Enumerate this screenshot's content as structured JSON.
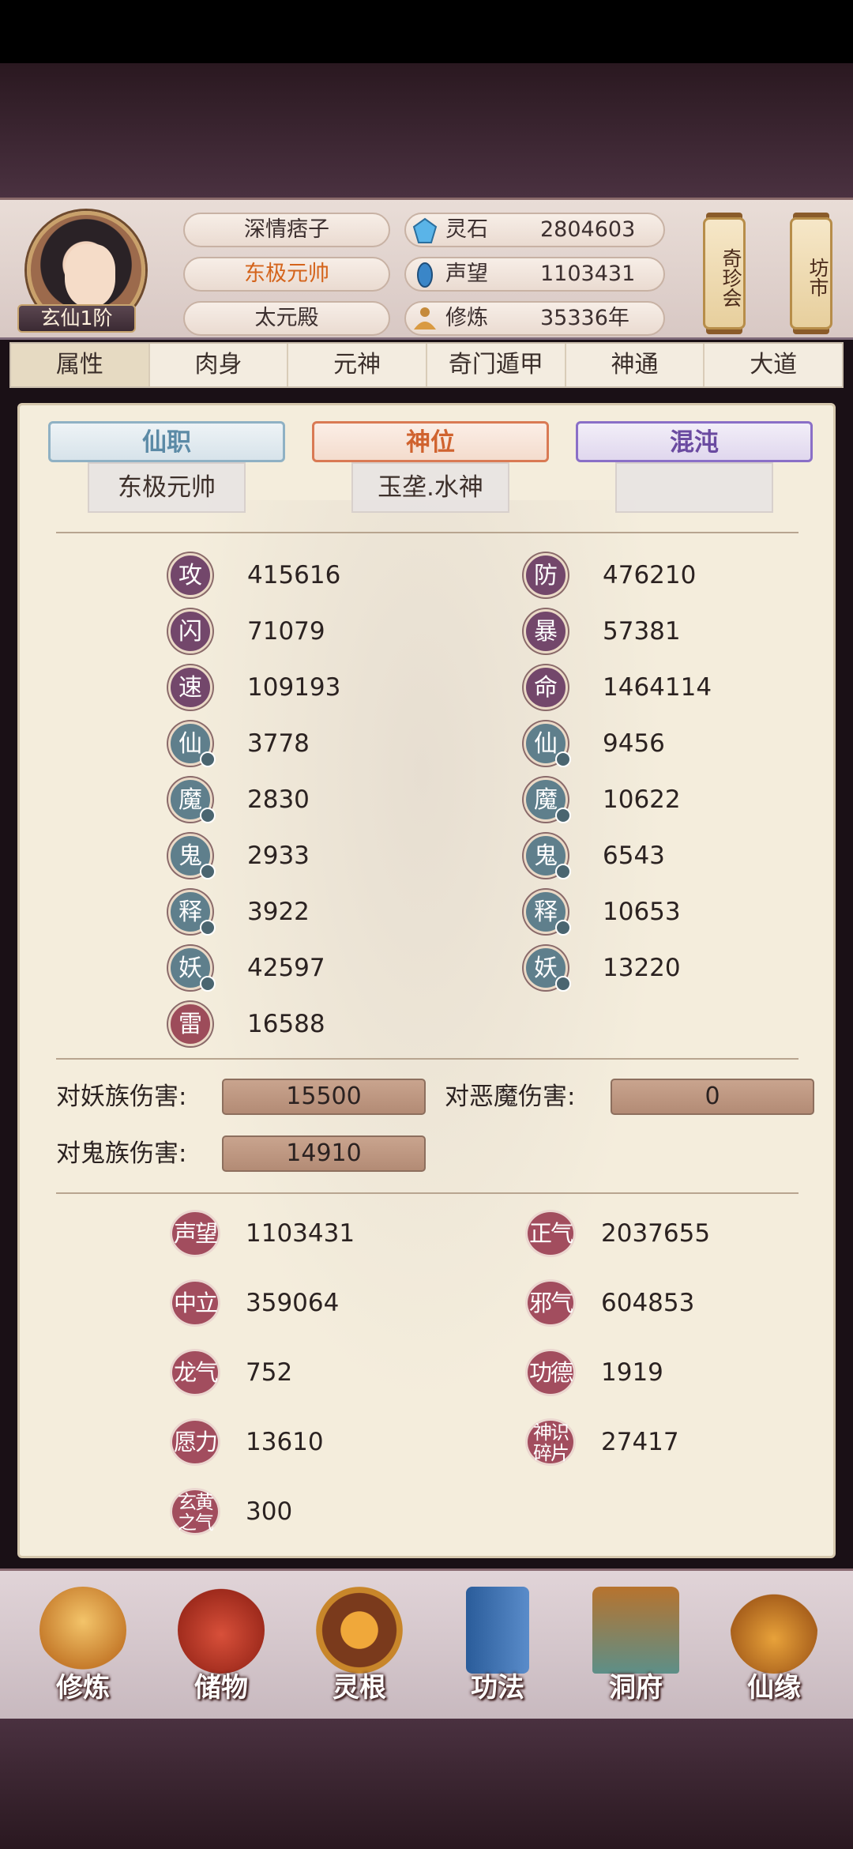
{
  "player": {
    "realm": "玄仙1阶",
    "name": "深情痞子",
    "title": "东极元帅",
    "palace": "太元殿"
  },
  "resources": [
    {
      "icon": "spirit-stone-icon",
      "label": "灵石",
      "value": "2804603"
    },
    {
      "icon": "prestige-icon",
      "label": "声望",
      "value": "1103431"
    },
    {
      "icon": "cultivation-icon",
      "label": "修炼",
      "value": "35336年"
    }
  ],
  "side_buttons": {
    "treasure_fair": "奇珍会",
    "market": "坊市"
  },
  "tabs": [
    "属性",
    "肉身",
    "元神",
    "奇门遁甲",
    "神通",
    "大道"
  ],
  "positions": {
    "immortal_post_title": "仙职",
    "immortal_post_value": "东极元帅",
    "divine_rank_title": "神位",
    "divine_rank_value": "玉垄.水神",
    "chaos_title": "混沌",
    "chaos_value": ""
  },
  "stats_left": [
    {
      "badge": "攻",
      "value": "415616",
      "color": "purple",
      "dot": false
    },
    {
      "badge": "闪",
      "value": "71079",
      "color": "purple",
      "dot": false
    },
    {
      "badge": "速",
      "value": "109193",
      "color": "purple",
      "dot": false
    },
    {
      "badge": "仙",
      "value": "3778",
      "color": "blue",
      "dot": true
    },
    {
      "badge": "魔",
      "value": "2830",
      "color": "blue",
      "dot": true
    },
    {
      "badge": "鬼",
      "value": "2933",
      "color": "blue",
      "dot": true
    },
    {
      "badge": "释",
      "value": "3922",
      "color": "blue",
      "dot": true
    },
    {
      "badge": "妖",
      "value": "42597",
      "color": "blue",
      "dot": true
    },
    {
      "badge": "雷",
      "value": "16588",
      "color": "red",
      "dot": false
    }
  ],
  "stats_right": [
    {
      "badge": "防",
      "value": "476210",
      "color": "purple",
      "dot": false
    },
    {
      "badge": "暴",
      "value": "57381",
      "color": "purple",
      "dot": false
    },
    {
      "badge": "命",
      "value": "1464114",
      "color": "purple",
      "dot": false
    },
    {
      "badge": "仙",
      "value": "9456",
      "color": "blue",
      "dot": true
    },
    {
      "badge": "魔",
      "value": "10622",
      "color": "blue",
      "dot": true
    },
    {
      "badge": "鬼",
      "value": "6543",
      "color": "blue",
      "dot": true
    },
    {
      "badge": "释",
      "value": "10653",
      "color": "blue",
      "dot": true
    },
    {
      "badge": "妖",
      "value": "13220",
      "color": "blue",
      "dot": true
    }
  ],
  "damage": {
    "demon_clan_label": "对妖族伤害:",
    "demon_clan_value": "15500",
    "evil_demon_label": "对恶魔伤害:",
    "evil_demon_value": "0",
    "ghost_clan_label": "对鬼族伤害:",
    "ghost_clan_value": "14910"
  },
  "misc_left": [
    {
      "badge": "声望",
      "value": "1103431"
    },
    {
      "badge": "中立",
      "value": "359064"
    },
    {
      "badge": "龙气",
      "value": "752"
    },
    {
      "badge": "愿力",
      "value": "13610"
    },
    {
      "badge": "玄黄之气",
      "value": "300"
    }
  ],
  "misc_right": [
    {
      "badge": "正气",
      "value": "2037655"
    },
    {
      "badge": "邪气",
      "value": "604853"
    },
    {
      "badge": "功德",
      "value": "1919"
    },
    {
      "badge": "神识碎片",
      "value": "27417"
    }
  ],
  "nav": [
    {
      "label": "修炼",
      "icon": "meditation-icon"
    },
    {
      "label": "储物",
      "icon": "storage-bag-icon"
    },
    {
      "label": "灵根",
      "icon": "spirit-root-icon"
    },
    {
      "label": "功法",
      "icon": "technique-book-icon"
    },
    {
      "label": "洞府",
      "icon": "cave-abode-icon"
    },
    {
      "label": "仙缘",
      "icon": "fate-gourd-icon"
    }
  ]
}
